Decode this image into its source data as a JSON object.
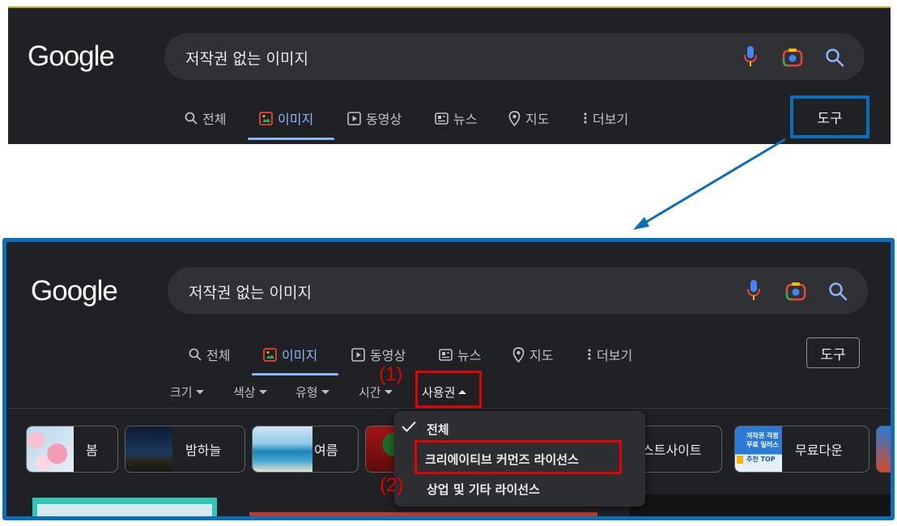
{
  "logo": "Google",
  "search": {
    "query": "저작권 없는 이미지"
  },
  "tabs": [
    {
      "label": "전체",
      "icon": "search-icon"
    },
    {
      "label": "이미지",
      "icon": "image-icon",
      "active": true
    },
    {
      "label": "동영상",
      "icon": "play-icon"
    },
    {
      "label": "뉴스",
      "icon": "news-icon"
    },
    {
      "label": "지도",
      "icon": "map-pin-icon"
    },
    {
      "label": "더보기",
      "icon": "more-vert-icon"
    }
  ],
  "tools_label": "도구",
  "filters": [
    {
      "label": "크기"
    },
    {
      "label": "색상"
    },
    {
      "label": "유형"
    },
    {
      "label": "시간"
    },
    {
      "label": "사용권",
      "open": true
    }
  ],
  "chips": [
    {
      "label": "봄"
    },
    {
      "label": "밤하늘"
    },
    {
      "label": "여름"
    },
    {
      "label": "스트사이트"
    },
    {
      "label": "무료다운"
    }
  ],
  "chip_thumb_text": [
    "저작권 걱정",
    "무료 일러스",
    "추천 TOP"
  ],
  "license_menu": {
    "items": [
      {
        "label": "전체",
        "checked": true
      },
      {
        "label": "크리에이티브 커먼즈 라이선스"
      },
      {
        "label": "상업 및 기타 라이선스"
      }
    ]
  },
  "annotations": {
    "step1": "(1)",
    "step2": "(2)"
  },
  "colors": {
    "background": "#202124",
    "search_bg": "#303134",
    "accent": "#8ab4f8",
    "annotation_blue": "#0a6ebd",
    "annotation_red": "#e60000"
  }
}
